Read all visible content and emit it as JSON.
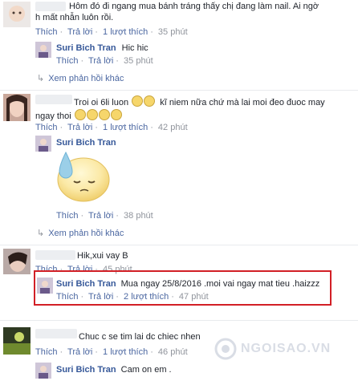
{
  "comments": [
    {
      "author": "",
      "text_line1": "Hôm đó đi ngang mua bánh tráng thấy chị đang làm nail. Ai ngờ",
      "text_line2": "h mất nhẫn luôn rồi.",
      "actions": {
        "like": "Thích",
        "reply": "Trả lời",
        "likes": "1 lượt thích",
        "time": "35 phút"
      },
      "reply": {
        "author": "Suri Bich Tran",
        "text": "Hic hic",
        "actions": {
          "like": "Thích",
          "reply": "Trả lời",
          "time": "35 phút"
        }
      },
      "more_replies": "Xem phản hồi khác"
    },
    {
      "author": "",
      "text_line1": "Troi oi 6li luon",
      "text_line1b": "kĩ niem nữa chứ mà lai moi đeo đuoc may",
      "text_line2": "ngay thoi",
      "actions": {
        "like": "Thích",
        "reply": "Trả lời",
        "likes": "1 lượt thích",
        "time": "42 phút"
      },
      "reply": {
        "author": "Suri Bich Tran",
        "text": "",
        "actions": {
          "like": "Thích",
          "reply": "Trả lời",
          "time": "38 phút"
        }
      },
      "more_replies": "Xem phản hồi khác"
    },
    {
      "author": "",
      "text_line1": "Hik,xui vay B",
      "actions": {
        "like": "Thích",
        "reply": "Trả lời",
        "time": "45 phút"
      },
      "reply": {
        "author": "Suri Bich Tran",
        "text": "Mua ngay 25/8/2016 .moi vai ngay mat tieu .haizzz",
        "actions": {
          "like": "Thích",
          "reply": "Trả lời",
          "likes": "2 lượt thích",
          "time": "47 phút"
        }
      }
    },
    {
      "author": "",
      "text_line1": "Chuc c se tim lai dc chiec nhen",
      "actions": {
        "like": "Thích",
        "reply": "Trả lời",
        "likes": "1 lượt thích",
        "time": "46 phút"
      },
      "reply": {
        "author": "Suri Bich Tran",
        "text": "Cam on em ."
      }
    }
  ],
  "watermark": "NGOISAO.VN",
  "colors": {
    "name": "#365899",
    "link": "#4b67a1",
    "meta": "#90949c",
    "highlight": "#d21f26"
  }
}
